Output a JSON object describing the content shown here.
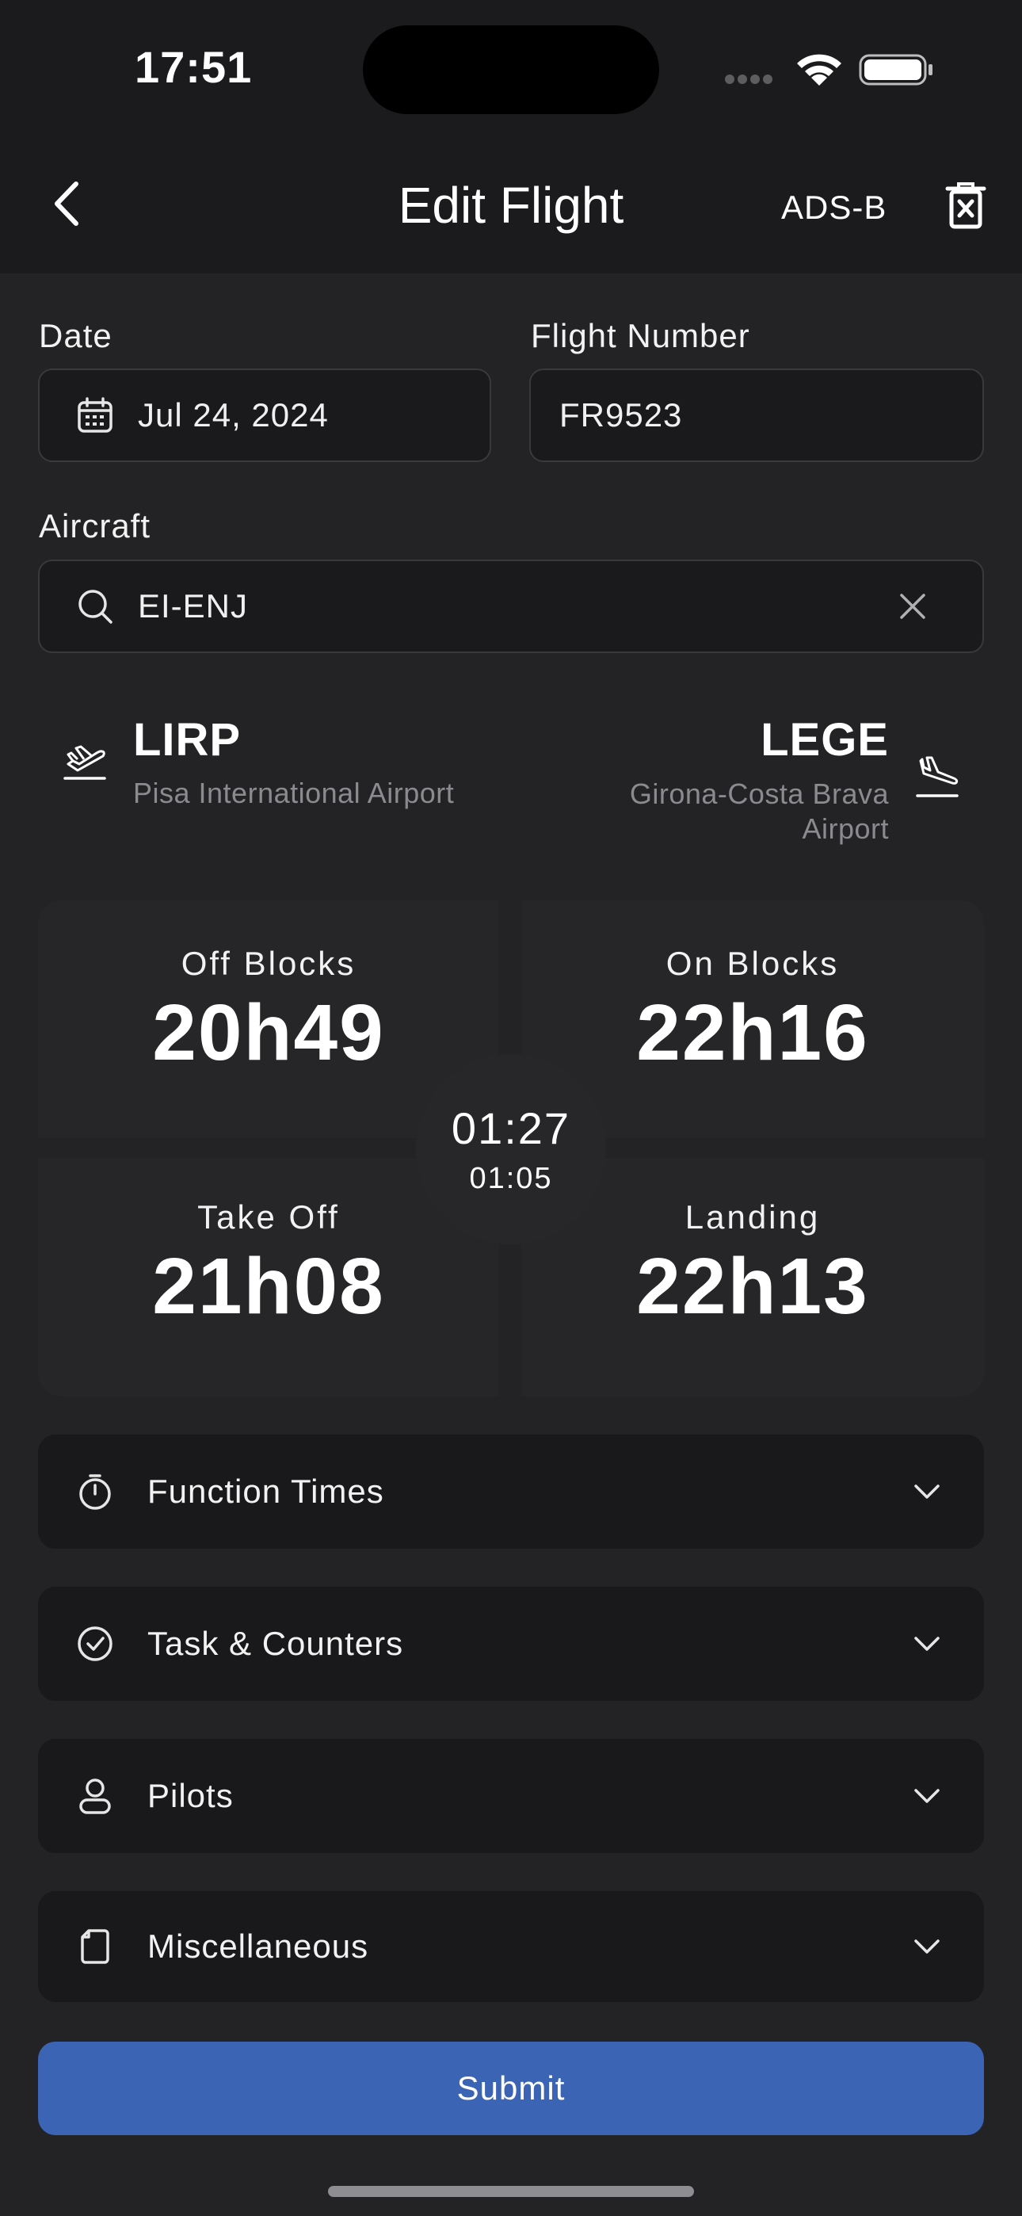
{
  "status_bar": {
    "time": "17:51"
  },
  "header": {
    "title": "Edit Flight",
    "ads_b_label": "ADS-B"
  },
  "form": {
    "date": {
      "label": "Date",
      "value": "Jul 24, 2024"
    },
    "flight_number": {
      "label": "Flight Number",
      "value": "FR9523"
    },
    "aircraft": {
      "label": "Aircraft",
      "value": "EI-ENJ"
    }
  },
  "route": {
    "departure": {
      "code": "LIRP",
      "name": "Pisa International Airport"
    },
    "arrival": {
      "code": "LEGE",
      "name_line1": "Girona-Costa Brava",
      "name_line2": "Airport"
    }
  },
  "times": {
    "off_blocks": {
      "label": "Off Blocks",
      "value": "20h49"
    },
    "on_blocks": {
      "label": "On Blocks",
      "value": "22h16"
    },
    "take_off": {
      "label": "Take Off",
      "value": "21h08"
    },
    "landing": {
      "label": "Landing",
      "value": "22h13"
    },
    "block_time": "01:27",
    "flight_time": "01:05"
  },
  "sections": [
    {
      "label": "Function Times",
      "icon": "stopwatch-icon"
    },
    {
      "label": "Task & Counters",
      "icon": "check-circle-icon"
    },
    {
      "label": "Pilots",
      "icon": "person-icon"
    },
    {
      "label": "Miscellaneous",
      "icon": "document-icon"
    }
  ],
  "submit_label": "Submit",
  "colors": {
    "background": "#232325",
    "accent": "#3c64b4",
    "field": "#1a1a1c"
  }
}
